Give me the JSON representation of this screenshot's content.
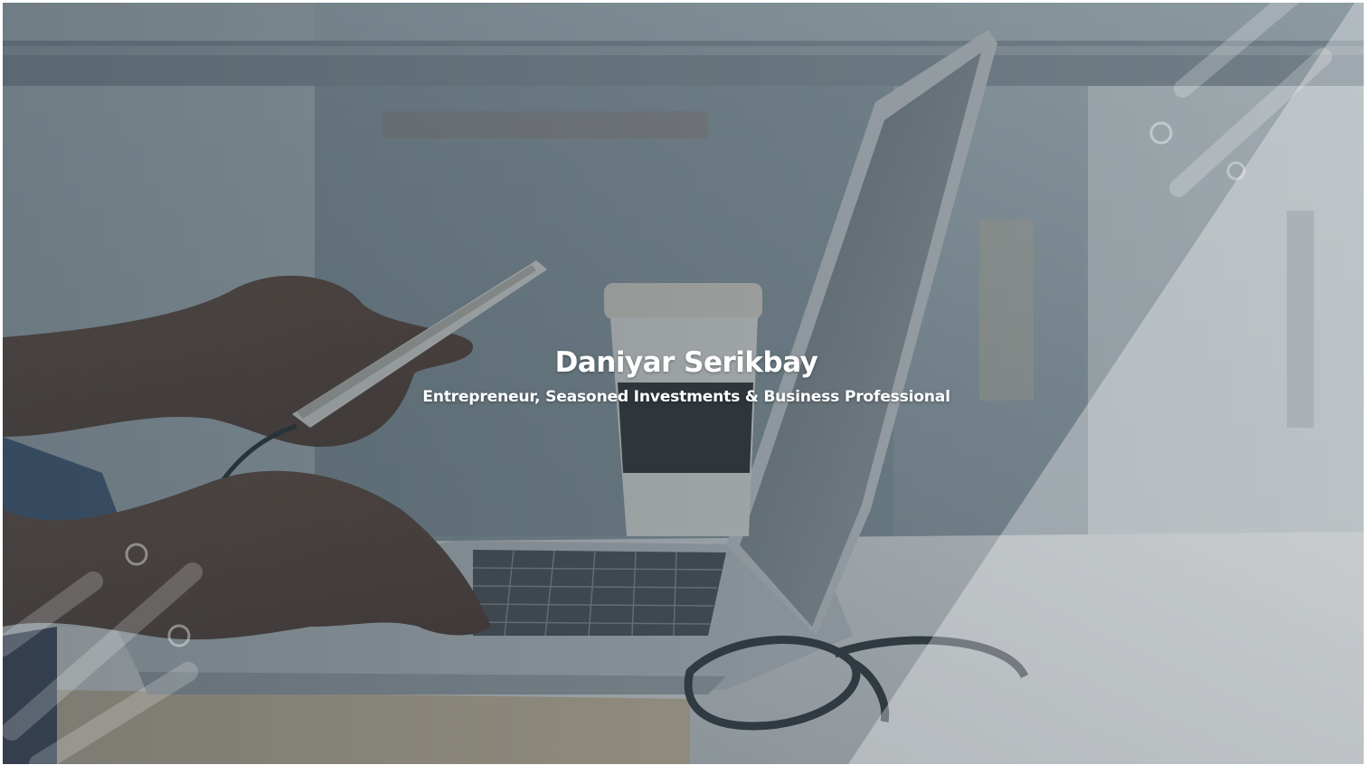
{
  "hero": {
    "title": "Daniyar Serikbay",
    "subtitle": "Entrepreneur, Seasoned Investments & Business Professional",
    "background_image": "laptop-workspace-photo",
    "overlay_color": "#4a5a66",
    "accent_overlay_color": "#ffffff"
  },
  "icons": {
    "top_right_circle": "ring-decoration-icon",
    "bottom_left_circle": "ring-decoration-icon",
    "diagonal_stripes": "stripe-decoration-icon"
  }
}
